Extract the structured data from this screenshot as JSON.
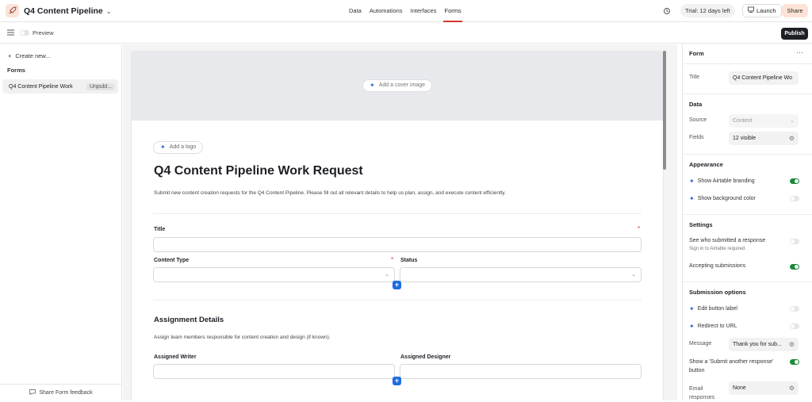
{
  "app": {
    "title": "Q4 Content Pipeline",
    "tabs": [
      "Data",
      "Automations",
      "Interfaces",
      "Forms"
    ],
    "active_tab": "Forms",
    "trial": "Trial: 12 days left",
    "launch": "Launch",
    "share": "Share",
    "publish": "Publish",
    "preview": "Preview"
  },
  "sidebar": {
    "create_new": "Create new...",
    "forms_heading": "Forms",
    "form_item_label": "Q4 Content Pipeline Work",
    "form_item_badge": "Unpubl...",
    "footer": "Share Form feedback"
  },
  "form": {
    "add_cover": "Add a cover image",
    "add_logo": "Add a logo",
    "title": "Q4 Content Pipeline Work Request",
    "description": "Submit new content creation requests for the Q4 Content Pipeline. Please fill out all relevant details to help us plan, assign, and execute content efficiently.",
    "fields": {
      "title": "Title",
      "content_type": "Content Type",
      "status": "Status",
      "assigned_writer": "Assigned Writer",
      "assigned_designer": "Assigned Designer"
    },
    "section_title": "Assignment Details",
    "section_desc": "Assign team members responsible for content creation and design (if known)."
  },
  "panel": {
    "header": "Form",
    "title_label": "Title",
    "title_value": "Q4 Content Pipeline Wo",
    "data_section": "Data",
    "source_label": "Source",
    "source_value": "Content",
    "fields_label": "Fields",
    "fields_value": "12 visible",
    "appearance_section": "Appearance",
    "show_branding": "Show Airtable branding",
    "show_background": "Show background color",
    "settings_section": "Settings",
    "see_who": "See who submitted a response",
    "see_who_sub": "Sign in to Airtable required.",
    "accepting": "Accepting submissions",
    "submission_section": "Submission options",
    "edit_button": "Edit button label",
    "redirect": "Redirect to URL",
    "message_label": "Message",
    "message_value": "Thank you for sub...",
    "show_submit_another": "Show a 'Submit another response' button",
    "email_label": "Email responses",
    "email_value": "None",
    "toggles": {
      "branding": true,
      "background": false,
      "see_who": false,
      "accepting": true,
      "edit_button": false,
      "redirect": false,
      "submit_another": true
    }
  }
}
